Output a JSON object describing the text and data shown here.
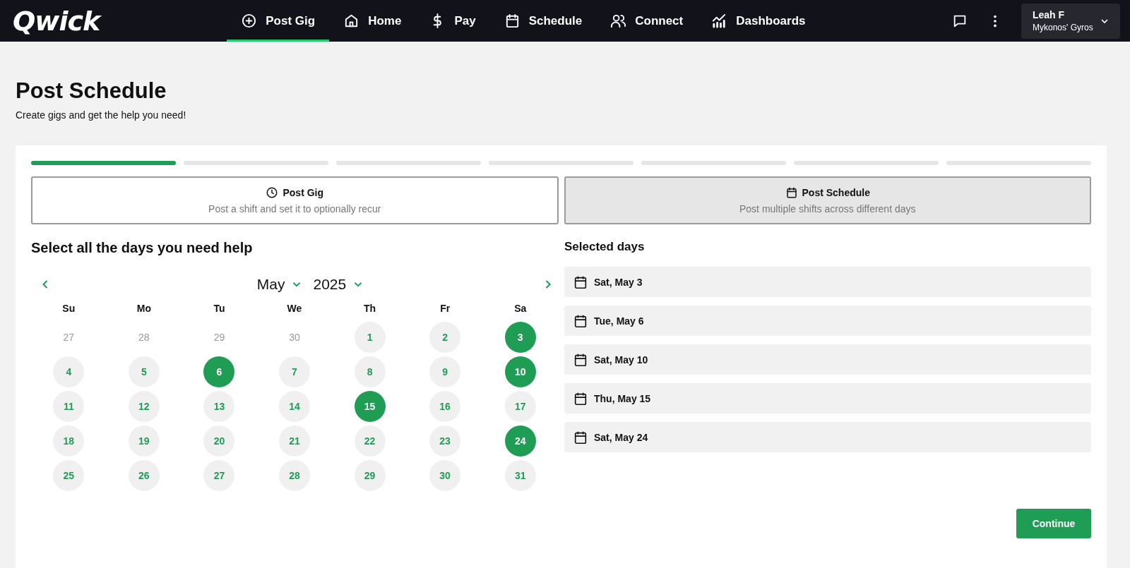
{
  "logo": "Qwick",
  "nav": [
    {
      "label": "Post Gig",
      "selected": true
    },
    {
      "label": "Home",
      "selected": false
    },
    {
      "label": "Pay",
      "selected": false
    },
    {
      "label": "Schedule",
      "selected": false
    },
    {
      "label": "Connect",
      "selected": false
    },
    {
      "label": "Dashboards",
      "selected": false
    }
  ],
  "account": {
    "name": "Leah F",
    "business": "Mykonos' Gyros"
  },
  "page": {
    "title": "Post Schedule",
    "subtitle": "Create gigs and get the help you need!"
  },
  "steps": [
    {
      "done": true
    },
    {
      "done": false
    },
    {
      "done": false
    },
    {
      "done": false
    },
    {
      "done": false
    },
    {
      "done": false
    },
    {
      "done": false
    }
  ],
  "modes": [
    {
      "title": "Post Gig",
      "subtitle": "Post a shift and set it to optionally recur",
      "selected": false
    },
    {
      "title": "Post Schedule",
      "subtitle": "Post multiple shifts across different days",
      "selected": true
    }
  ],
  "calendar": {
    "heading": "Select all the days you need help",
    "month": "May",
    "year": "2025",
    "weekdays": [
      "Su",
      "Mo",
      "Tu",
      "We",
      "Th",
      "Fr",
      "Sa"
    ],
    "days": [
      {
        "label": "27",
        "outside": true,
        "selected": false
      },
      {
        "label": "28",
        "outside": true,
        "selected": false
      },
      {
        "label": "29",
        "outside": true,
        "selected": false
      },
      {
        "label": "30",
        "outside": true,
        "selected": false
      },
      {
        "label": "1",
        "outside": false,
        "selected": false
      },
      {
        "label": "2",
        "outside": false,
        "selected": false
      },
      {
        "label": "3",
        "outside": false,
        "selected": true
      },
      {
        "label": "4",
        "outside": false,
        "selected": false
      },
      {
        "label": "5",
        "outside": false,
        "selected": false
      },
      {
        "label": "6",
        "outside": false,
        "selected": true
      },
      {
        "label": "7",
        "outside": false,
        "selected": false
      },
      {
        "label": "8",
        "outside": false,
        "selected": false
      },
      {
        "label": "9",
        "outside": false,
        "selected": false
      },
      {
        "label": "10",
        "outside": false,
        "selected": true
      },
      {
        "label": "11",
        "outside": false,
        "selected": false
      },
      {
        "label": "12",
        "outside": false,
        "selected": false
      },
      {
        "label": "13",
        "outside": false,
        "selected": false
      },
      {
        "label": "14",
        "outside": false,
        "selected": false
      },
      {
        "label": "15",
        "outside": false,
        "selected": true
      },
      {
        "label": "16",
        "outside": false,
        "selected": false
      },
      {
        "label": "17",
        "outside": false,
        "selected": false
      },
      {
        "label": "18",
        "outside": false,
        "selected": false
      },
      {
        "label": "19",
        "outside": false,
        "selected": false
      },
      {
        "label": "20",
        "outside": false,
        "selected": false
      },
      {
        "label": "21",
        "outside": false,
        "selected": false
      },
      {
        "label": "22",
        "outside": false,
        "selected": false
      },
      {
        "label": "23",
        "outside": false,
        "selected": false
      },
      {
        "label": "24",
        "outside": false,
        "selected": true
      },
      {
        "label": "25",
        "outside": false,
        "selected": false
      },
      {
        "label": "26",
        "outside": false,
        "selected": false
      },
      {
        "label": "27",
        "outside": false,
        "selected": false
      },
      {
        "label": "28",
        "outside": false,
        "selected": false
      },
      {
        "label": "29",
        "outside": false,
        "selected": false
      },
      {
        "label": "30",
        "outside": false,
        "selected": false
      },
      {
        "label": "31",
        "outside": false,
        "selected": false
      }
    ]
  },
  "selected_days": {
    "heading": "Selected days",
    "items": [
      "Sat, May 3",
      "Tue, May 6",
      "Sat, May 10",
      "Thu, May 15",
      "Sat, May 24"
    ]
  },
  "continue_button": "Continue"
}
